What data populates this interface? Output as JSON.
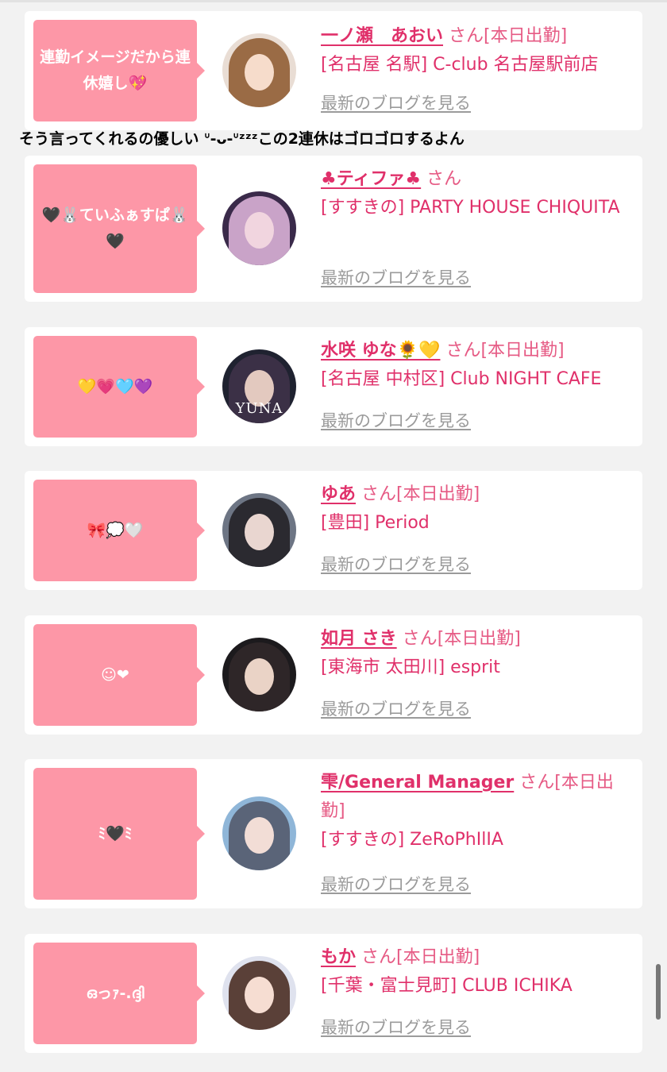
{
  "caption": "そう言ってくれるの優しい ᐡ-ᴗ-ᐡᶻᶻᶻこの2連休はゴロゴロするよん",
  "blog_label": "最新のブログを見る",
  "san_label": "さん",
  "cards": [
    {
      "bubble": "連勤イメージだから連休嬉し💖",
      "name": "一ノ瀬　あおい",
      "status": "[本日出勤]",
      "shop": "[名古屋 名駅] C-club 名古屋駅前店",
      "avatar_text": ""
    },
    {
      "bubble": "🖤🐰ていふぁすぱ🐰🖤",
      "name": "♣ティファ♣",
      "status": "",
      "shop": "[すすきの] PARTY HOUSE CHIQUITA",
      "avatar_text": ""
    },
    {
      "bubble": "💛💗🩵💜",
      "name": "水咲 ゆな🌻💛",
      "status": "[本日出勤]",
      "shop": "[名古屋 中村区] Club NIGHT CAFE",
      "avatar_text": "YUNA"
    },
    {
      "bubble": "🎀💭🤍",
      "name": "ゆあ",
      "status": "[本日出勤]",
      "shop": "[豊田] Period",
      "avatar_text": ""
    },
    {
      "bubble": "☺︎❤",
      "name": "如月 さき",
      "status": "[本日出勤]",
      "shop": "[東海市 太田川] esprit",
      "avatar_text": ""
    },
    {
      "bubble": "ﾐ🖤ﾐ",
      "name": "雫/General Manager",
      "status": "[本日出勤]",
      "shop": "[すすきの] ZeRoPhIlIA",
      "avatar_text": ""
    },
    {
      "bubble": "ഒっｧ-.ദ്ദി",
      "name": "もか",
      "status": "[本日出勤]",
      "shop": "[千葉・富士見町] CLUB ICHIKA",
      "avatar_text": ""
    }
  ],
  "colors": {
    "bubble": "#fd97a7",
    "name": "#e0306a",
    "blog": "#9b9b9b",
    "bg": "#f2f2f2"
  }
}
